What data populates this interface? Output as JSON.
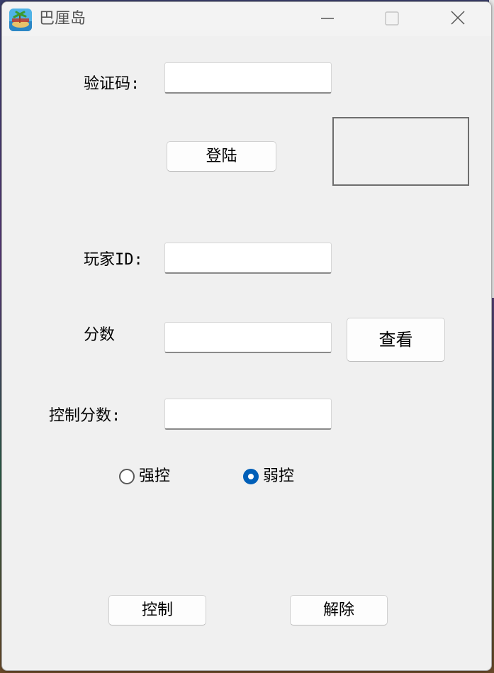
{
  "window": {
    "title": "巴厘岛",
    "controls": {
      "minimize": "minimize-icon",
      "maximize": "maximize-icon",
      "close": "close-icon"
    }
  },
  "form": {
    "captcha_label": "验证码:",
    "captcha_value": "",
    "login_label": "登陆",
    "player_id_label": "玩家ID:",
    "player_id_value": "",
    "score_label": "分数",
    "score_value": "",
    "view_label": "查看",
    "control_score_label": "控制分数:",
    "control_score_value": ""
  },
  "mode": {
    "options": [
      {
        "label": "强控",
        "selected": false
      },
      {
        "label": "弱控",
        "selected": true
      }
    ]
  },
  "actions": {
    "control_label": "控制",
    "release_label": "解除"
  },
  "colors": {
    "window_bg": "#f0f0f0",
    "accent": "#005fb8",
    "title_text": "#555555"
  }
}
